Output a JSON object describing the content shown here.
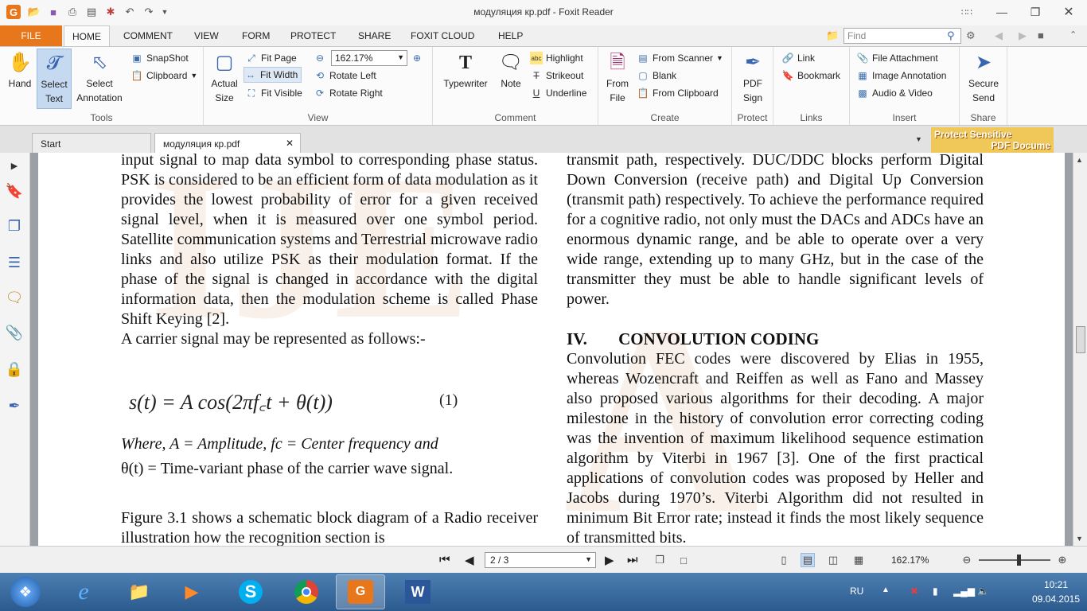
{
  "window": {
    "title": "модуляция кр.pdf - Foxit Reader"
  },
  "menu": {
    "file": "FILE",
    "tabs": [
      "HOME",
      "COMMENT",
      "VIEW",
      "FORM",
      "PROTECT",
      "SHARE",
      "FOXIT CLOUD",
      "HELP"
    ],
    "find_placeholder": "Find"
  },
  "ribbon": {
    "tools": {
      "label": "Tools",
      "hand": "Hand",
      "select_text_1": "Select",
      "select_text_2": "Text",
      "select_annot_1": "Select",
      "select_annot_2": "Annotation",
      "snapshot": "SnapShot",
      "clipboard": "Clipboard"
    },
    "view": {
      "label": "View",
      "actual_size_1": "Actual",
      "actual_size_2": "Size",
      "fit_page": "Fit Page",
      "fit_width": "Fit Width",
      "fit_visible": "Fit Visible",
      "zoom": "162.17%",
      "rotate_left": "Rotate Left",
      "rotate_right": "Rotate Right"
    },
    "comment": {
      "label": "Comment",
      "typewriter": "Typewriter",
      "note": "Note",
      "highlight": "Highlight",
      "strikeout": "Strikeout",
      "underline": "Underline"
    },
    "create": {
      "label": "Create",
      "from_file_1": "From",
      "from_file_2": "File",
      "from_scanner": "From Scanner",
      "blank": "Blank",
      "from_clipboard": "From Clipboard"
    },
    "protect": {
      "label": "Protect",
      "pdf_sign_1": "PDF",
      "pdf_sign_2": "Sign"
    },
    "links": {
      "label": "Links",
      "link": "Link",
      "bookmark": "Bookmark"
    },
    "insert": {
      "label": "Insert",
      "file_attachment": "File Attachment",
      "image_annotation": "Image Annotation",
      "audio_video": "Audio & Video"
    },
    "share": {
      "label": "Share",
      "secure_send_1": "Secure",
      "secure_send_2": "Send"
    }
  },
  "doc_tabs": [
    "Start",
    "модуляция кр.pdf"
  ],
  "ad": {
    "line1": "Protect Sensitive",
    "line2": "PDF Docume"
  },
  "document": {
    "left_column": {
      "para1": "input signal to map data symbol to corresponding phase status. PSK is considered to be an efficient form of data modulation as it provides the lowest probability of error for a given received signal level, when it is measured over one symbol period. Satellite communication systems and Terrestrial microwave radio links and also utilize PSK as their modulation format. If the phase of the signal is changed in accordance with the digital information data, then the modulation scheme is called Phase Shift Keying [2].",
      "para2": "A carrier signal may be represented as follows:-",
      "equation": "s(t) = A cos(2πf꜀t + θ(t))",
      "equation_number": "(1)",
      "where_line": "Where, A = Amplitude, fc = Center frequency and",
      "theta_line": "θ(t) = Time-variant phase of the carrier wave signal.",
      "para3": "Figure 3.1 shows a schematic block diagram of a Radio receiver illustration how the recognition section is"
    },
    "right_column": {
      "para1": "transmit path, respectively. DUC/DDC blocks perform Digital Down Conversion (receive path) and Digital Up Conversion (transmit path) respectively. To achieve the performance required for a cognitive radio, not only must the DACs and ADCs have an enormous dynamic range, and be able to operate over a very wide range, extending up to many GHz, but in the case of the transmitter they must be able to handle significant levels of power.",
      "heading_num": "IV.",
      "heading": "CONVOLUTION CODING",
      "para2": "Convolution FEC codes were discovered by Elias in 1955, whereas Wozencraft and Reiffen as well as Fano and Massey also proposed various algorithms for their decoding. A major milestone in the history of convolution error correcting coding was the invention of maximum likelihood sequence estimation algorithm by Viterbi in 1967 [3]. One of the first practical applications of convolution codes was proposed by Heller and Jacobs during 1970’s. Viterbi Algorithm did not resulted in minimum Bit Error rate; instead it finds the most likely sequence of transmitted bits."
    }
  },
  "statusbar": {
    "page": "2 / 3",
    "zoom": "162.17%"
  },
  "taskbar": {
    "lang": "RU",
    "time": "10:21",
    "date": "09.04.2015"
  },
  "colors": {
    "file_tab": "#e8761b",
    "accent": "#3a66b0",
    "taskbar": "#2b5a8f"
  }
}
